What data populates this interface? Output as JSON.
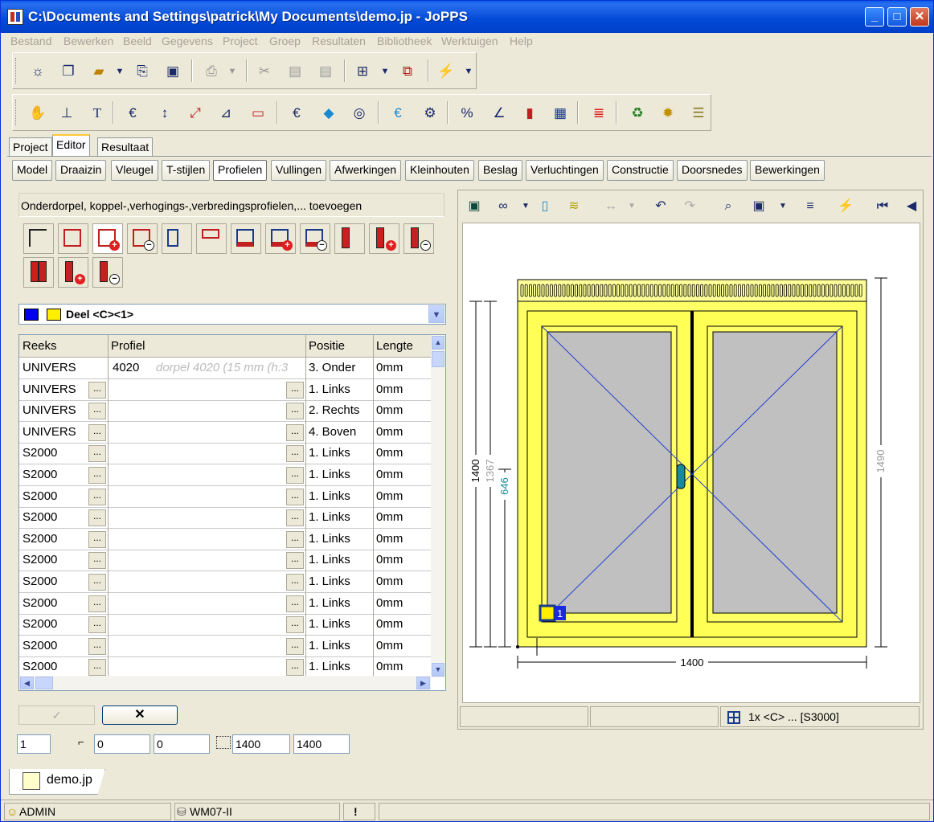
{
  "window": {
    "title": "C:\\Documents and Settings\\patrick\\My Documents\\demo.jp - JoPPS"
  },
  "menu": [
    "Bestand",
    "Bewerken",
    "Beeld",
    "Gegevens",
    "Project",
    "Groep",
    "Resultaten",
    "Bibliotheek",
    "Werktuigen",
    "Help"
  ],
  "main_tabs": [
    "Project",
    "Editor",
    "Resultaat"
  ],
  "editor_tabs": [
    "Model",
    "Draaizin",
    "Vleugel",
    "T-stijlen",
    "Profielen",
    "Vullingen",
    "Afwerkingen",
    "Kleinhouten",
    "Beslag",
    "Verluchtingen",
    "Constructie",
    "Doorsnedes",
    "Bewerkingen"
  ],
  "panel": {
    "description": "Onderdorpel, koppel-,verhogings-,verbredingsprofielen,... toevoegen",
    "part_selector": "Deel <C><1>",
    "cancel_symbol": "✕",
    "ok_symbol": "✓"
  },
  "grid": {
    "columns": [
      "Reeks",
      "Profiel",
      "Positie",
      "Lengte"
    ],
    "rows": [
      {
        "reeks": "UNIVERS",
        "profiel": "4020",
        "ghost": "dorpel 4020 (15 mm (h:3",
        "positie": "3. Onder",
        "lengte": "0mm"
      },
      {
        "reeks": "UNIVERS",
        "profiel": "",
        "ghost": "",
        "positie": "1. Links",
        "lengte": "0mm"
      },
      {
        "reeks": "UNIVERS",
        "profiel": "",
        "ghost": "",
        "positie": "2. Rechts",
        "lengte": "0mm"
      },
      {
        "reeks": "UNIVERS",
        "profiel": "",
        "ghost": "",
        "positie": "4. Boven",
        "lengte": "0mm"
      },
      {
        "reeks": "S2000",
        "profiel": "",
        "ghost": "",
        "positie": "1. Links",
        "lengte": "0mm"
      },
      {
        "reeks": "S2000",
        "profiel": "",
        "ghost": "",
        "positie": "1. Links",
        "lengte": "0mm"
      },
      {
        "reeks": "S2000",
        "profiel": "",
        "ghost": "",
        "positie": "1. Links",
        "lengte": "0mm"
      },
      {
        "reeks": "S2000",
        "profiel": "",
        "ghost": "",
        "positie": "1. Links",
        "lengte": "0mm"
      },
      {
        "reeks": "S2000",
        "profiel": "",
        "ghost": "",
        "positie": "1. Links",
        "lengte": "0mm"
      },
      {
        "reeks": "S2000",
        "profiel": "",
        "ghost": "",
        "positie": "1. Links",
        "lengte": "0mm"
      },
      {
        "reeks": "S2000",
        "profiel": "",
        "ghost": "",
        "positie": "1. Links",
        "lengte": "0mm"
      },
      {
        "reeks": "S2000",
        "profiel": "",
        "ghost": "",
        "positie": "1. Links",
        "lengte": "0mm"
      },
      {
        "reeks": "S2000",
        "profiel": "",
        "ghost": "",
        "positie": "1. Links",
        "lengte": "0mm"
      },
      {
        "reeks": "S2000",
        "profiel": "",
        "ghost": "",
        "positie": "1. Links",
        "lengte": "0mm"
      },
      {
        "reeks": "S2000",
        "profiel": "",
        "ghost": "",
        "positie": "1. Links",
        "lengte": "0mm"
      }
    ]
  },
  "fields": {
    "count": "1",
    "x": "0",
    "y": "0",
    "width": "1400",
    "height": "1400"
  },
  "drawing": {
    "dim_width": "1400",
    "dim_total_height": "1400",
    "dim_frame_height": "1367",
    "dim_handle_height": "646",
    "dim_right": "1490",
    "part_number": "1"
  },
  "view_status": "1x <C> ... [S3000]",
  "doc_tab": "demo.jp",
  "status": {
    "user": "ADMIN",
    "db": "WM07-II",
    "alert": "!"
  },
  "colors": {
    "frame_yellow": "#ffff66",
    "glass": "#c0c0c0",
    "diag": "#2040d0",
    "title_blue": "#0a5fe8"
  }
}
